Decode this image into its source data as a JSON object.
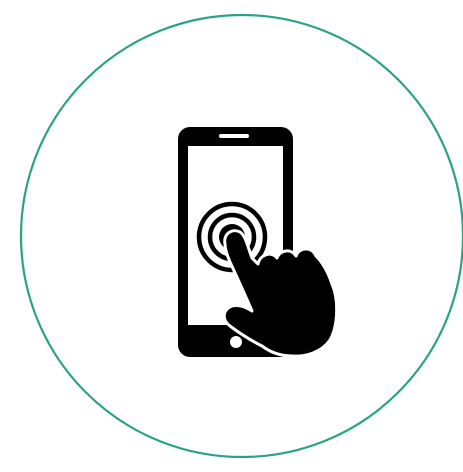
{
  "illustration": {
    "subject": "touchscreen-tap-icon",
    "colors": {
      "ring": "#2aa384",
      "icon": "#000000",
      "screen": "#ffffff",
      "background": "#ffffff"
    }
  }
}
